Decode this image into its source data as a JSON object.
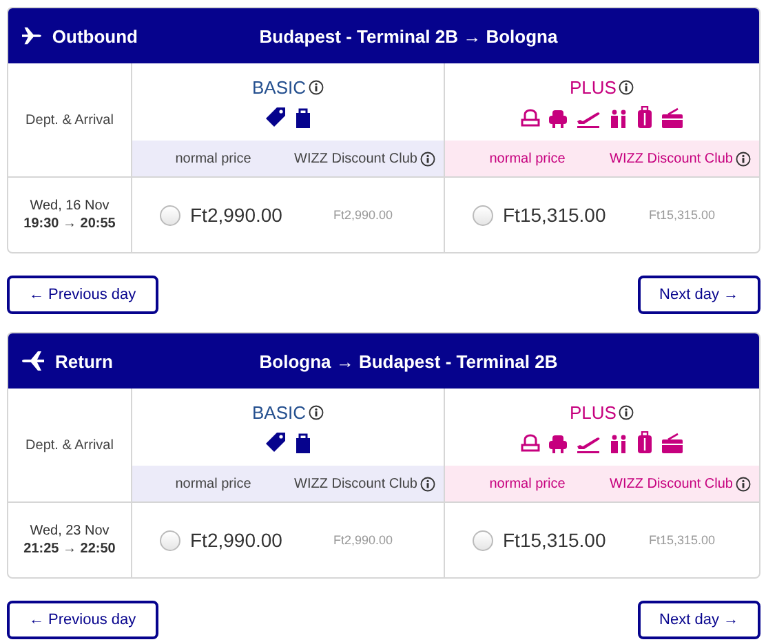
{
  "flights": [
    {
      "kind": "outbound",
      "direction": "Outbound",
      "route": "Budapest - Terminal 2B → Bologna",
      "date_column_label": "Dept. & Arrival",
      "date": "Wed, 16 Nov",
      "times": "19:30 → 20:55",
      "fares": [
        {
          "kind": "basic",
          "name": "BASIC",
          "normal_label": "normal price",
          "club_label": "WIZZ Discount Club",
          "price": "Ft2,990.00",
          "club_price": "Ft2,990.00",
          "selected": false
        },
        {
          "kind": "plus",
          "name": "PLUS",
          "normal_label": "normal price",
          "club_label": "WIZZ Discount Club",
          "price": "Ft15,315.00",
          "club_price": "Ft15,315.00",
          "selected": false
        }
      ],
      "buttons": [
        "← Previous day",
        "Next day →"
      ]
    },
    {
      "kind": "return",
      "direction": "Return",
      "route": "Bologna → Budapest - Terminal 2B",
      "date_column_label": "Dept. & Arrival",
      "date": "Wed, 23 Nov",
      "times": "21:25 → 22:50",
      "fares": [
        {
          "kind": "basic",
          "name": "BASIC",
          "normal_label": "normal price",
          "club_label": "WIZZ Discount Club",
          "price": "Ft2,990.00",
          "club_price": "Ft2,990.00",
          "selected": false
        },
        {
          "kind": "plus",
          "name": "PLUS",
          "normal_label": "normal price",
          "club_label": "WIZZ Discount Club",
          "price": "Ft15,315.00",
          "club_price": "Ft15,315.00",
          "selected": false
        }
      ],
      "buttons": [
        "← Previous day",
        "Next day →"
      ]
    }
  ]
}
